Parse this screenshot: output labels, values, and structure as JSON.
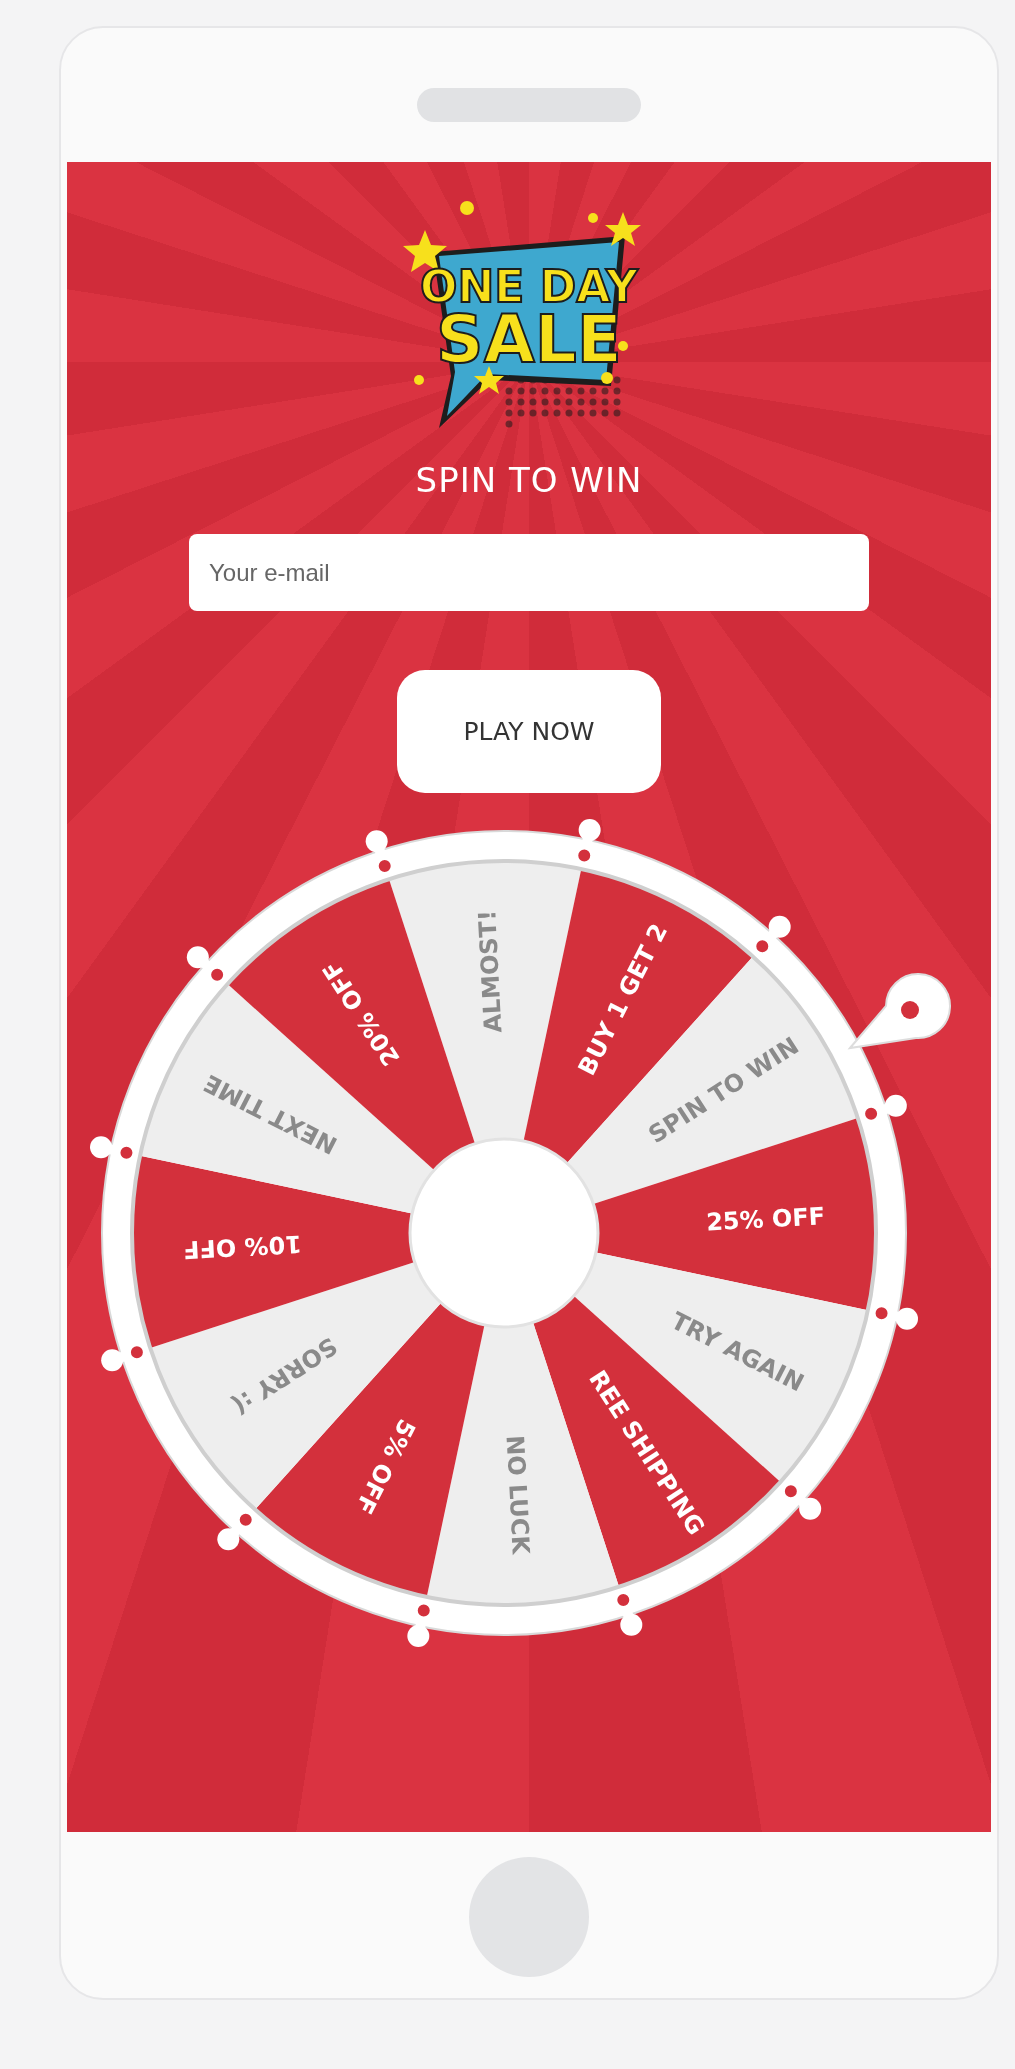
{
  "logo": {
    "line_1": "ONE DAY",
    "line_2": "SALE"
  },
  "heading": "SPIN TO WIN",
  "email_field": {
    "placeholder": "Your e-mail"
  },
  "play_button": "PLAY NOW",
  "wheel": {
    "segments": [
      {
        "label": "ALMOST!",
        "color": "#eeeeee",
        "kind": "light"
      },
      {
        "label": "BUY 1 GET 2",
        "color": "#d3303c",
        "kind": "dark"
      },
      {
        "label": "SPIN TO WIN",
        "color": "#eeeeee",
        "kind": "light"
      },
      {
        "label": "25% OFF",
        "color": "#d3303c",
        "kind": "dark"
      },
      {
        "label": "TRY AGAIN",
        "color": "#eeeeee",
        "kind": "light"
      },
      {
        "label": "REE SHIPPING",
        "color": "#d3303c",
        "kind": "dark"
      },
      {
        "label": "NO LUCK",
        "color": "#eeeeee",
        "kind": "light"
      },
      {
        "label": "5% OFF",
        "color": "#d3303c",
        "kind": "dark"
      },
      {
        "label": "SORRY :(",
        "color": "#eeeeee",
        "kind": "light"
      },
      {
        "label": "10% OFF",
        "color": "#d3303c",
        "kind": "dark"
      },
      {
        "label": "NEXT TIME",
        "color": "#eeeeee",
        "kind": "light"
      },
      {
        "label": "20% OFF",
        "color": "#d3303c",
        "kind": "dark"
      }
    ]
  }
}
